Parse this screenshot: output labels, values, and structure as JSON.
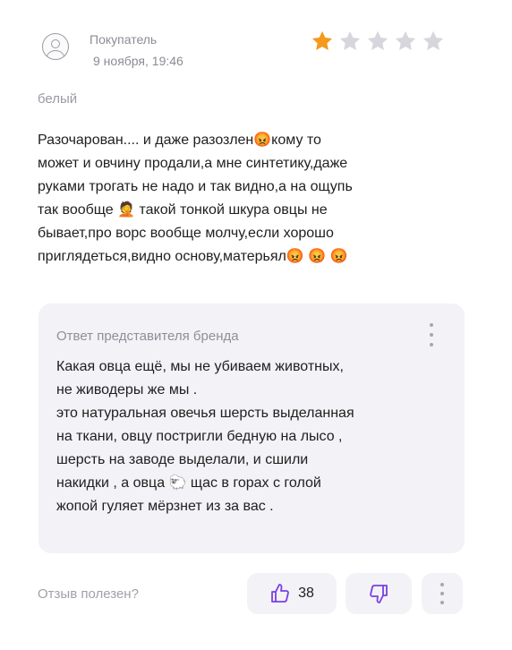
{
  "review": {
    "author": "Покупатель",
    "date": "9 ноября, 19:46",
    "rating": 1,
    "rating_max": 5,
    "variant": "белый",
    "text_lines": [
      "Разочарован.... и даже разозлен😡кому то",
      "может и овчину продали,а мне синтетику,даже",
      "руками трогать не надо и так видно,а на ощупь",
      "так вообще 🤦 такой тонкой шкура овцы не",
      "бывает,про ворс вообще молчу,если хорошо",
      "приглядеться,видно основу,матерьял😡 😡 😡"
    ]
  },
  "brand_reply": {
    "title": "Ответ представителя бренда",
    "text_lines": [
      "Какая овца ещё, мы не убиваем животных,",
      "не живодеры же мы .",
      "это натуральная овечья шерсть выделанная",
      "на ткани, овцу постригли бедную на лысо ,",
      "шерсть на заводе выделали,  и сшили",
      "накидки , а овца 🐑  щас в горах с голой",
      "жопой гуляет мёрзнет из за вас ."
    ]
  },
  "footer": {
    "helpful_label": "Отзыв полезен?",
    "likes": "38"
  },
  "colors": {
    "star_filled": "#f49a1c",
    "star_empty": "#d6d6dc",
    "reply_bg": "#f2f2f7",
    "accent": "#7b3fe4"
  },
  "icons": {
    "avatar": "user-icon",
    "star": "star-icon",
    "like": "thumbs-up-icon",
    "dislike": "thumbs-down-icon",
    "more": "more-vertical-icon"
  }
}
